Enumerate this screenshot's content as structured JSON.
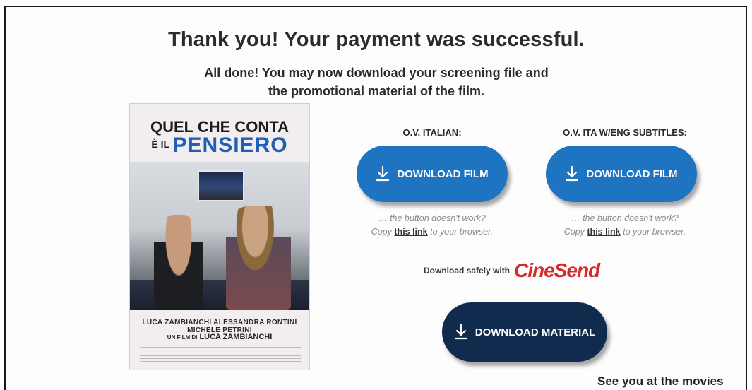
{
  "page": {
    "headline": "Thank you! Your payment was successful.",
    "subline_1": "All done! You may now download your screening file and",
    "subline_2": "the promotional material of the film.",
    "footer": "See you at the movies"
  },
  "poster": {
    "title_line1": "QUEL CHE CONTA",
    "title_small": "È IL",
    "title_big": "PENSIERO",
    "cast": "LUCA ZAMBIANCHI   ALESSANDRA RONTINI   MICHELE PETRINI",
    "director_prefix": "UN FILM DI",
    "director": "LUCA ZAMBIANCHI"
  },
  "downloads": [
    {
      "label": "O.V. ITALIAN:",
      "button": "DOWNLOAD FILM",
      "hint_line1": "… the button doesn't work?",
      "hint_pre": "Copy ",
      "hint_link": "this link",
      "hint_post": " to your browser."
    },
    {
      "label": "O.V. ITA W/ENG SUBTITLES:",
      "button": "DOWNLOAD FILM",
      "hint_line1": "… the button doesn't work?",
      "hint_pre": "Copy ",
      "hint_link": "this link",
      "hint_post": " to your browser."
    }
  ],
  "safe": {
    "text": "Download safely with",
    "brand": "CineSend"
  },
  "material": {
    "button": "DOWNLOAD MATERIAL"
  },
  "colors": {
    "button_blue": "#1f74c2",
    "button_dark": "#102b4d",
    "brand_red": "#d42a2a"
  }
}
